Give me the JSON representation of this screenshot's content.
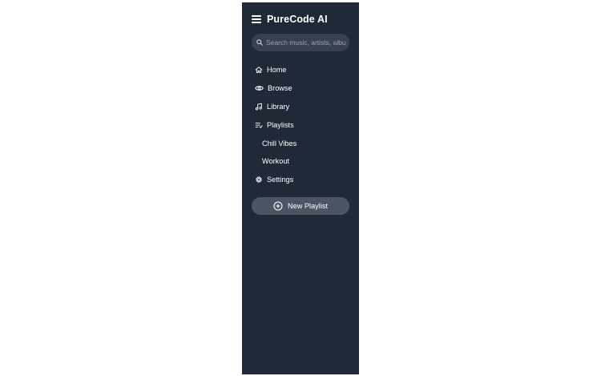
{
  "app": {
    "title": "PureCode AI"
  },
  "search": {
    "placeholder": "Search music, artists, albums..."
  },
  "nav": {
    "items": [
      {
        "label": "Home",
        "icon": "home-icon"
      },
      {
        "label": "Browse",
        "icon": "eye-icon"
      },
      {
        "label": "Library",
        "icon": "music-note-icon"
      },
      {
        "label": "Playlists",
        "icon": "playlist-icon"
      }
    ],
    "playlists": [
      "Chill Vibes",
      "Workout"
    ],
    "settings": {
      "label": "Settings",
      "icon": "gear-icon"
    }
  },
  "actions": {
    "new_playlist": "New Playlist"
  },
  "colors": {
    "sidebar_bg": "#1f2937",
    "search_bg": "#374151",
    "button_bg": "#4b5563",
    "text": "#ffffff"
  }
}
